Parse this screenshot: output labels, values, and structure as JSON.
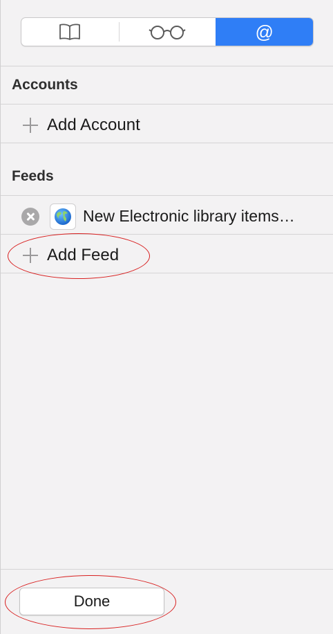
{
  "toolbar": {
    "tabs": [
      {
        "name": "bookmarks",
        "icon": "book-icon",
        "label": ""
      },
      {
        "name": "reading-list",
        "icon": "glasses-icon",
        "label": ""
      },
      {
        "name": "shared-links",
        "icon": "at-icon",
        "label": "@",
        "active": true
      }
    ]
  },
  "accounts": {
    "header": "Accounts",
    "add_label": "Add Account"
  },
  "feeds": {
    "header": "Feeds",
    "items": [
      {
        "title": "New Electronic library items…",
        "icon": "globe-icon"
      }
    ],
    "add_label": "Add Feed"
  },
  "footer": {
    "done_label": "Done"
  },
  "colors": {
    "accent": "#2f7ef6",
    "annotation": "#d81f1f"
  }
}
